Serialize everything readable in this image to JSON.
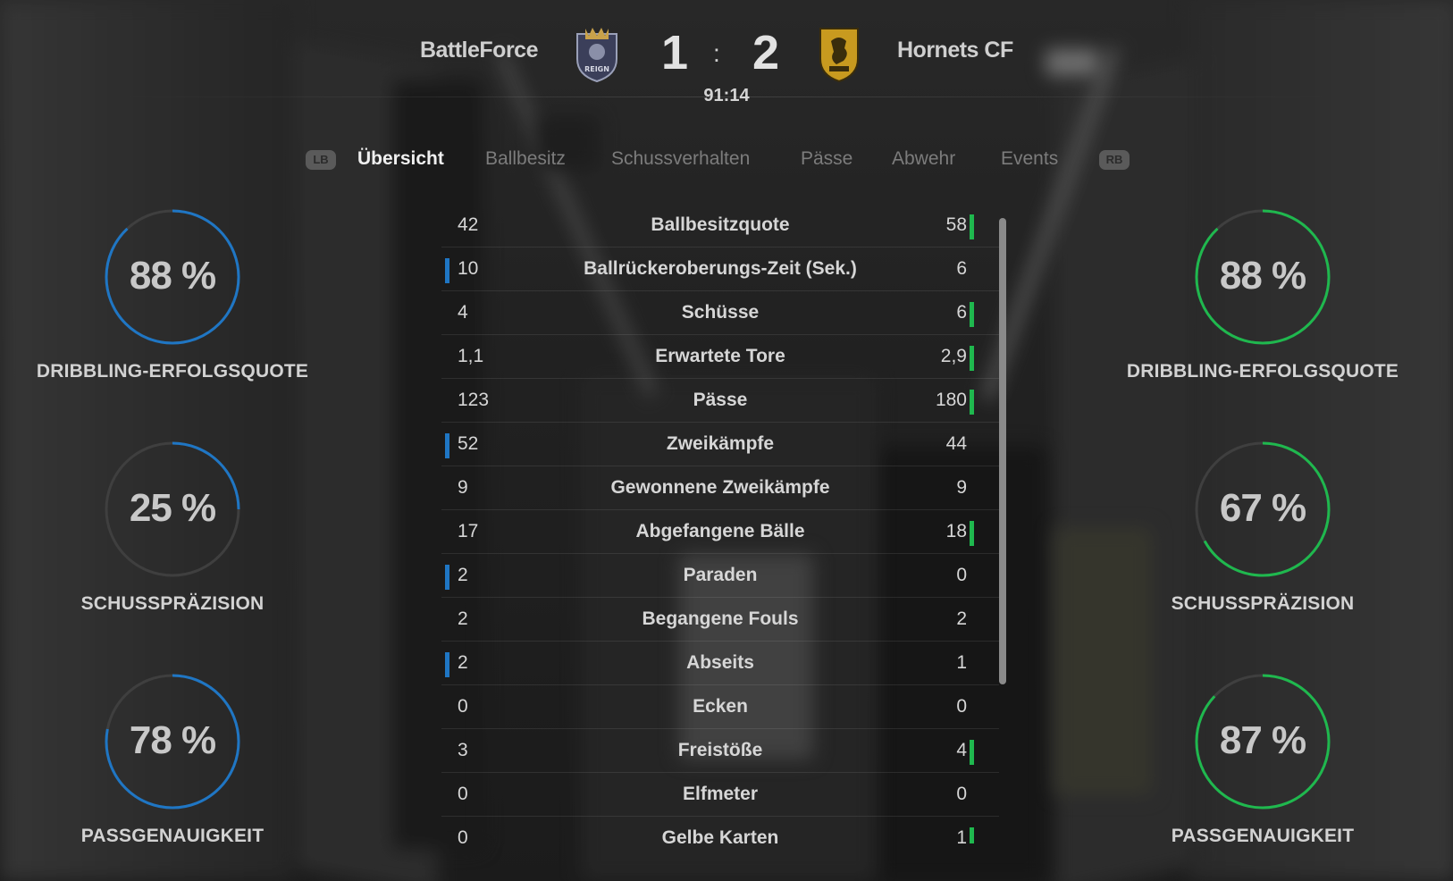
{
  "match": {
    "home_team": "BattleForce",
    "away_team": "Hornets CF",
    "home_score": "1",
    "away_score": "2",
    "separator": ":",
    "clock": "91:14",
    "home_crest_text": "REIGN"
  },
  "tabs": {
    "lb": "LB",
    "rb": "RB",
    "items": [
      "Übersicht",
      "Ballbesitz",
      "Schussverhalten",
      "Pässe",
      "Abwehr",
      "Events"
    ],
    "active_index": 0
  },
  "colors": {
    "home_accent": "#1f76c4",
    "away_accent": "#1fb84e",
    "ring_track": "#3f3f3f"
  },
  "gauges": {
    "home": [
      {
        "value": "88 %",
        "fraction": 0.88,
        "label": "DRIBBLING-ERFOLGSQUOTE"
      },
      {
        "value": "25 %",
        "fraction": 0.25,
        "label": "SCHUSSPRÄZISION"
      },
      {
        "value": "78 %",
        "fraction": 0.78,
        "label": "PASSGENAUIGKEIT"
      }
    ],
    "away": [
      {
        "value": "88 %",
        "fraction": 0.88,
        "label": "DRIBBLING-ERFOLGSQUOTE"
      },
      {
        "value": "67 %",
        "fraction": 0.67,
        "label": "SCHUSSPRÄZISION"
      },
      {
        "value": "87 %",
        "fraction": 0.87,
        "label": "PASSGENAUIGKEIT"
      }
    ]
  },
  "stats": [
    {
      "label": "Ballbesitzquote",
      "home": "42",
      "away": "58",
      "leader": "away"
    },
    {
      "label": "Ballrückeroberungs-Zeit (Sek.)",
      "home": "10",
      "away": "6",
      "leader": "home"
    },
    {
      "label": "Schüsse",
      "home": "4",
      "away": "6",
      "leader": "away"
    },
    {
      "label": "Erwartete Tore",
      "home": "1,1",
      "away": "2,9",
      "leader": "away"
    },
    {
      "label": "Pässe",
      "home": "123",
      "away": "180",
      "leader": "away"
    },
    {
      "label": "Zweikämpfe",
      "home": "52",
      "away": "44",
      "leader": "home"
    },
    {
      "label": "Gewonnene Zweikämpfe",
      "home": "9",
      "away": "9",
      "leader": "none"
    },
    {
      "label": "Abgefangene Bälle",
      "home": "17",
      "away": "18",
      "leader": "away"
    },
    {
      "label": "Paraden",
      "home": "2",
      "away": "0",
      "leader": "home"
    },
    {
      "label": "Begangene Fouls",
      "home": "2",
      "away": "2",
      "leader": "none"
    },
    {
      "label": "Abseits",
      "home": "2",
      "away": "1",
      "leader": "home"
    },
    {
      "label": "Ecken",
      "home": "0",
      "away": "0",
      "leader": "none"
    },
    {
      "label": "Freistöße",
      "home": "3",
      "away": "4",
      "leader": "away"
    },
    {
      "label": "Elfmeter",
      "home": "0",
      "away": "0",
      "leader": "none"
    },
    {
      "label": "Gelbe Karten",
      "home": "0",
      "away": "1",
      "leader": "away"
    }
  ]
}
